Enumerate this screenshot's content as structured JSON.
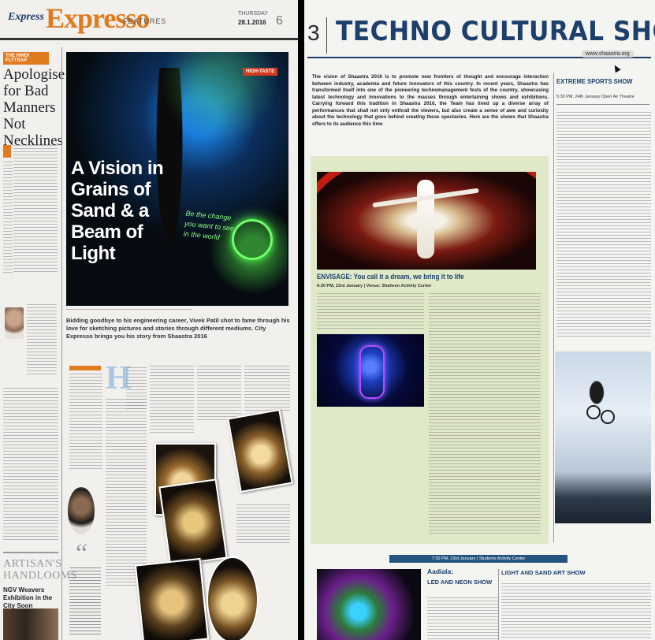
{
  "left_page": {
    "masthead": {
      "brand_small": "Express",
      "brand_big": "Expresso",
      "section": "FEATURES",
      "day": "THURSDAY",
      "date": "28.1.2016",
      "page_no": "6"
    },
    "column_tag": "THE HINDI FLYTRAP",
    "opinion_headline": "Apologise for Bad Manners Not Necklines",
    "hero": {
      "tag": "HIGH-TASTE",
      "headline": "A Vision in Grains of Sand & a Beam of Light",
      "sand_text": "Be the change you want to see in the world"
    },
    "standfirst": "Bidding goodbye to his engineering career, Vivek Patil shot to fame through his love for sketching pictures and stories through different mediums. City Expresso brings you his story from Shaastra 2016",
    "drop_cap": "H",
    "side_label": "ARTISAN'S HANDLOOMS",
    "side_sub": "NGV Weavers Exhibition in the City Soon",
    "quote_mark": "“"
  },
  "right_page": {
    "page_no": "3",
    "title": "TECHNO CULTURAL SHOWS",
    "url": "www.shaastra.org",
    "intro": "The vision of Shaastra 2016 is to promote new frontiers of thought and encourage interaction between industry, academia and future innovators of this country. In recent years, Shaastra has transformed itself into one of the pioneering technomanagement fests of the country, showcasing latest technology and innovations to the masses through entertaining shows and exhibitions. Carrying forward this tradition in Shaastra 2016, the Team has lined up a diverse array of performances that shall not only enthrall the viewers, but also create a sense of awe and curiosity about the technology that goes behind creating these spectacles. Here are the shows that Shaastra offers to its audience this time",
    "envisage": {
      "title": "ENVISAGE: You call it a dream, we bring it to life",
      "meta": "6:30 PM, 23rd January | Venue: Shaheen Activity Center"
    },
    "extreme": {
      "title": "EXTREME SPORTS SHOW",
      "meta": "5:30 PM, 24th January    Open Air Theatre"
    },
    "bottom_bar": "7:30 PM, 23rd January | Students Activity Center",
    "aadiala": {
      "title": "Aadiala:",
      "subtitle": "LED AND NEON SHOW"
    },
    "light_sand": {
      "title": "LIGHT AND SAND ART SHOW"
    }
  },
  "colors": {
    "accent_orange": "#e07a1f",
    "title_navy": "#1d3f6b",
    "panel_green": "#dfe9c8",
    "bar_blue": "#25537f"
  }
}
